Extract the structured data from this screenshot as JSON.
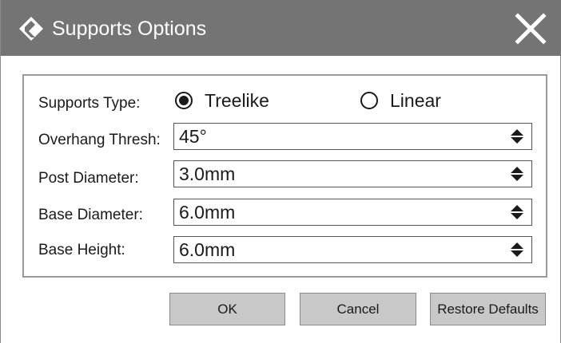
{
  "window": {
    "title": "Supports Options",
    "app_icon": "diamond-logo-icon",
    "close_icon": "close-icon",
    "titlebar_color": "#747474"
  },
  "supports_type": {
    "label": "Supports Type:",
    "options": [
      {
        "label": "Treelike",
        "selected": true
      },
      {
        "label": "Linear",
        "selected": false
      }
    ]
  },
  "fields": {
    "overhang": {
      "label": "Overhang Thresh:",
      "value": "45°"
    },
    "post_diameter": {
      "label": "Post Diameter:",
      "value": "3.0mm"
    },
    "base_diameter": {
      "label": "Base Diameter:",
      "value": "6.0mm"
    },
    "base_height": {
      "label": "Base Height:",
      "value": "6.0mm"
    }
  },
  "buttons": {
    "ok": "OK",
    "cancel": "Cancel",
    "restore": "Restore Defaults"
  }
}
